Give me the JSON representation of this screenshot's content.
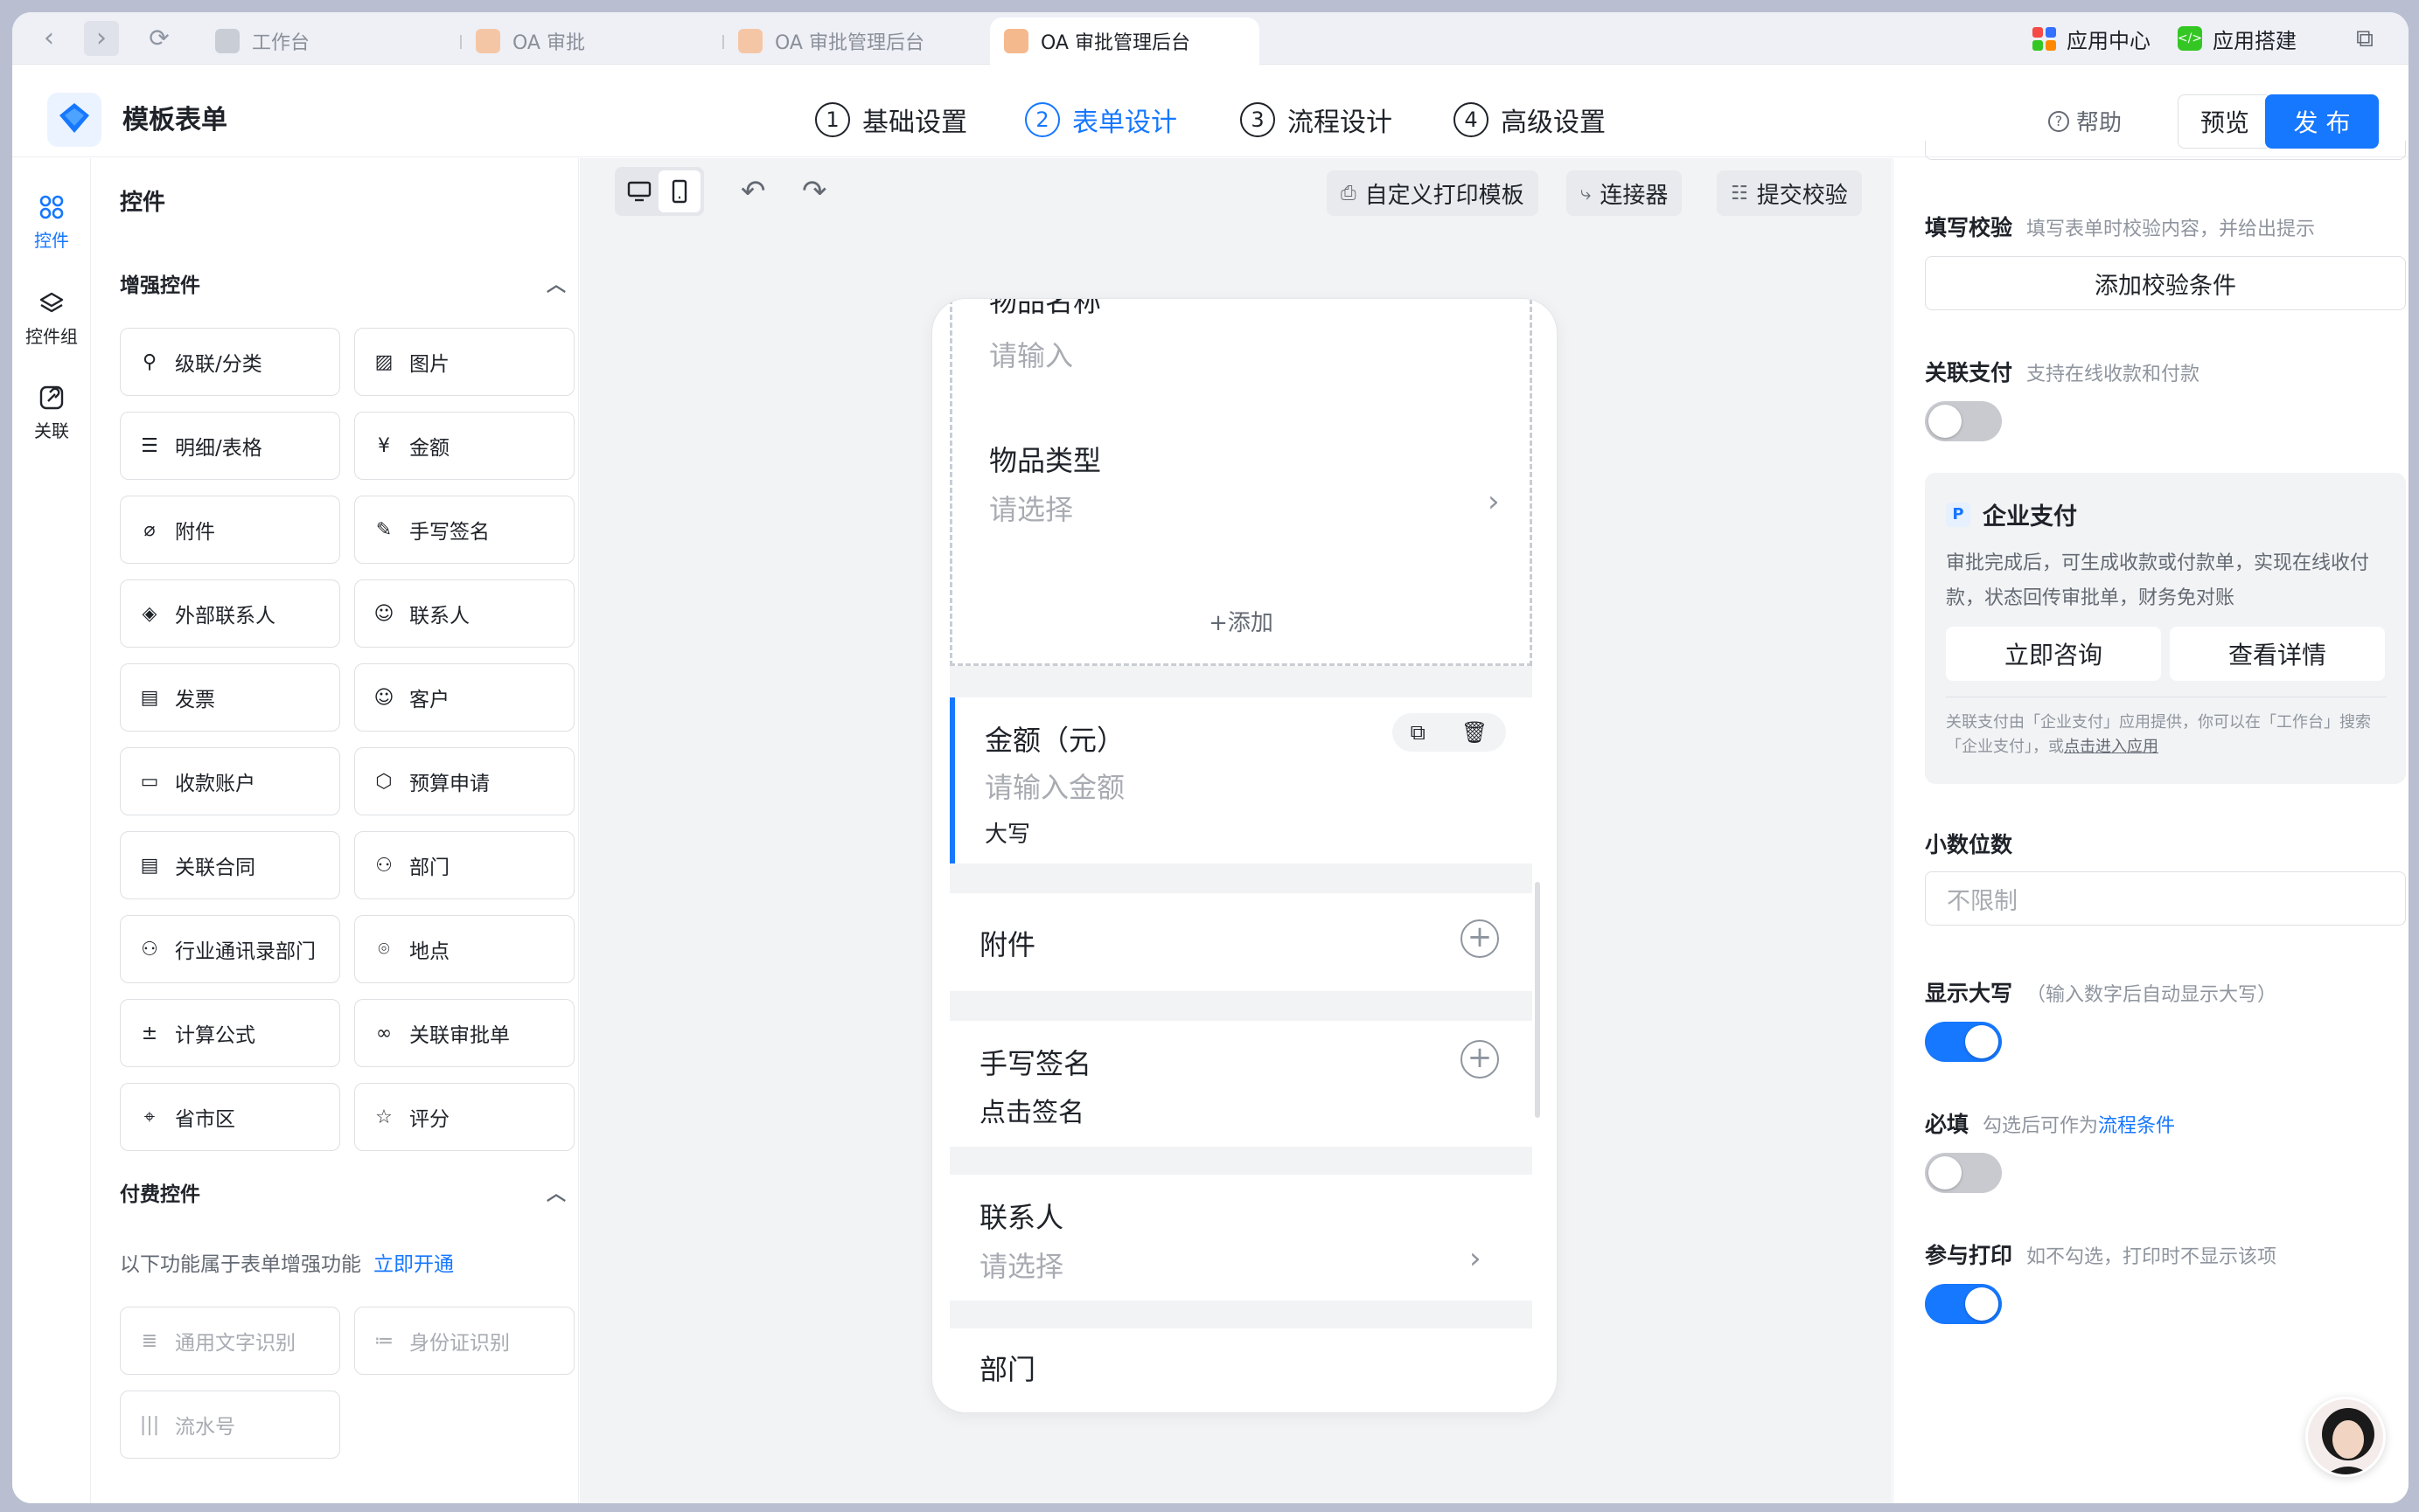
{
  "browser": {
    "tabs": [
      {
        "label": "工作台",
        "active": false
      },
      {
        "label": "OA 审批",
        "active": false
      },
      {
        "label": "OA 审批管理后台",
        "active": false
      },
      {
        "label": "OA 审批管理后台",
        "active": true
      }
    ],
    "app_center": "应用中心",
    "app_builder": "应用搭建"
  },
  "header": {
    "title": "模板表单",
    "steps": [
      {
        "num": "1",
        "label": "基础设置",
        "active": false
      },
      {
        "num": "2",
        "label": "表单设计",
        "active": true
      },
      {
        "num": "3",
        "label": "流程设计",
        "active": false
      },
      {
        "num": "4",
        "label": "高级设置",
        "active": false
      }
    ],
    "help": "帮助",
    "preview": "预览",
    "publish": "发 布"
  },
  "rail": {
    "items": [
      {
        "label": "控件",
        "icon": "grid-icon",
        "active": true
      },
      {
        "label": "控件组",
        "icon": "layers-icon",
        "active": false
      },
      {
        "label": "关联",
        "icon": "link-icon",
        "active": false
      }
    ]
  },
  "controls": {
    "title": "控件",
    "enhanced_title": "增强控件",
    "enhanced": [
      {
        "label": "级联/分类",
        "icon": "person-tree-icon",
        "glyph": "⚲"
      },
      {
        "label": "图片",
        "icon": "image-icon",
        "glyph": "▨"
      },
      {
        "label": "明细/表格",
        "icon": "table-icon",
        "glyph": "☰"
      },
      {
        "label": "金额",
        "icon": "yen-icon",
        "glyph": "¥"
      },
      {
        "label": "附件",
        "icon": "paperclip-icon",
        "glyph": "⌀"
      },
      {
        "label": "手写签名",
        "icon": "pen-icon",
        "glyph": "✎"
      },
      {
        "label": "外部联系人",
        "icon": "handshake-icon",
        "glyph": "◈"
      },
      {
        "label": "联系人",
        "icon": "person-icon",
        "glyph": "☺"
      },
      {
        "label": "发票",
        "icon": "invoice-icon",
        "glyph": "▤"
      },
      {
        "label": "客户",
        "icon": "customer-icon",
        "glyph": "☺"
      },
      {
        "label": "收款账户",
        "icon": "card-icon",
        "glyph": "▭"
      },
      {
        "label": "预算申请",
        "icon": "cube-icon",
        "glyph": "⬡"
      },
      {
        "label": "关联合同",
        "icon": "contract-icon",
        "glyph": "▤"
      },
      {
        "label": "部门",
        "icon": "org-icon",
        "glyph": "⚇"
      },
      {
        "label": "行业通讯录部门",
        "icon": "org-tree-icon",
        "glyph": "⚇"
      },
      {
        "label": "地点",
        "icon": "location-pin-icon",
        "glyph": "⌾"
      },
      {
        "label": "计算公式",
        "icon": "formula-icon",
        "glyph": "±"
      },
      {
        "label": "关联审批单",
        "icon": "link-chain-icon",
        "glyph": "∞"
      },
      {
        "label": "省市区",
        "icon": "map-icon",
        "glyph": "⌖"
      },
      {
        "label": "评分",
        "icon": "star-icon",
        "glyph": "☆"
      }
    ],
    "paid_title": "付费控件",
    "paid_note": "以下功能属于表单增强功能",
    "paid_link": "立即开通",
    "paid": [
      {
        "label": "通用文字识别",
        "icon": "text-ocr-icon",
        "glyph": "≣"
      },
      {
        "label": "身份证识别",
        "icon": "id-card-icon",
        "glyph": "≔"
      },
      {
        "label": "流水号",
        "icon": "barcode-icon",
        "glyph": "|||"
      }
    ]
  },
  "toolbar": {
    "print_template": "自定义打印模板",
    "connector": "连接器",
    "submit_check": "提交校验"
  },
  "form": {
    "item_name_partial": "物品名称",
    "item_name_ph": "请输入",
    "item_type_label": "物品类型",
    "item_type_ph": "请选择",
    "add": "+添加",
    "amount_label": "金额（元）",
    "amount_ph": "请输入金额",
    "amount_caps": "大写",
    "attachment_label": "附件",
    "signature_label": "手写签名",
    "signature_action": "点击签名",
    "contact_label": "联系人",
    "contact_ph": "请选择",
    "dept_label": "部门"
  },
  "props": {
    "validate_label": "填写校验",
    "validate_hint": "填写表单时校验内容，并给出提示",
    "validate_btn": "添加校验条件",
    "pay_label": "关联支付",
    "pay_hint": "支持在线收款和付款",
    "pay_on": false,
    "pay_card": {
      "title": "企业支付",
      "desc": "审批完成后，可生成收款或付款单，实现在线收付款，状态回传审批单，财务免对账",
      "consult": "立即咨询",
      "details": "查看详情",
      "footnote": "关联支付由「企业支付」应用提供，你可以在「工作台」搜索「企业支付」，或",
      "footnote_link": "点击进入应用"
    },
    "decimals_label": "小数位数",
    "decimals_ph": "不限制",
    "caps_label": "显示大写",
    "caps_hint": "（输入数字后自动显示大写）",
    "caps_on": true,
    "required_label": "必填",
    "required_hint": "勾选后可作为",
    "required_link": "流程条件",
    "required_on": false,
    "print_label": "参与打印",
    "print_hint": "如不勾选，打印时不显示该项",
    "print_on": true
  },
  "colors": {
    "accent": "#1677ff",
    "toggle_off": "#c8cacf",
    "canvas_bg": "#f2f3f5"
  }
}
